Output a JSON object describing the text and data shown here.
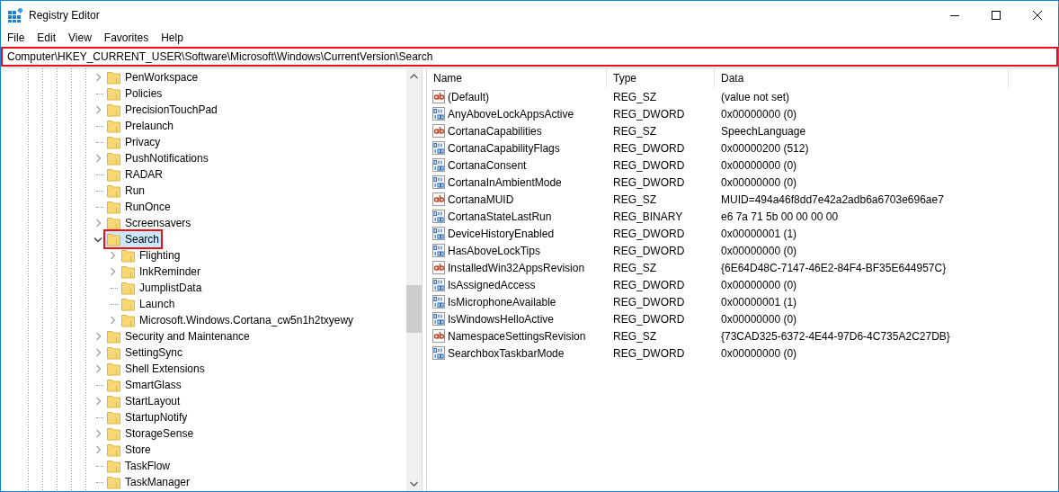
{
  "window": {
    "title": "Registry Editor"
  },
  "menu": [
    {
      "label": "File"
    },
    {
      "label": "Edit"
    },
    {
      "label": "View"
    },
    {
      "label": "Favorites"
    },
    {
      "label": "Help"
    }
  ],
  "address_bar": {
    "value": "Computer\\HKEY_CURRENT_USER\\Software\\Microsoft\\Windows\\CurrentVersion\\Search",
    "highlighted": true
  },
  "tree": [
    {
      "label": "PenWorkspace",
      "expandable": true,
      "expanded": false,
      "selected": false,
      "highlighted": false
    },
    {
      "label": "Policies",
      "expandable": false,
      "expanded": false,
      "selected": false,
      "highlighted": false
    },
    {
      "label": "PrecisionTouchPad",
      "expandable": true,
      "expanded": false,
      "selected": false,
      "highlighted": false
    },
    {
      "label": "Prelaunch",
      "expandable": false,
      "expanded": false,
      "selected": false,
      "highlighted": false
    },
    {
      "label": "Privacy",
      "expandable": false,
      "expanded": false,
      "selected": false,
      "highlighted": false
    },
    {
      "label": "PushNotifications",
      "expandable": true,
      "expanded": false,
      "selected": false,
      "highlighted": false
    },
    {
      "label": "RADAR",
      "expandable": false,
      "expanded": false,
      "selected": false,
      "highlighted": false
    },
    {
      "label": "Run",
      "expandable": false,
      "expanded": false,
      "selected": false,
      "highlighted": false
    },
    {
      "label": "RunOnce",
      "expandable": false,
      "expanded": false,
      "selected": false,
      "highlighted": false
    },
    {
      "label": "Screensavers",
      "expandable": true,
      "expanded": false,
      "selected": false,
      "highlighted": false
    },
    {
      "label": "Search",
      "expandable": true,
      "expanded": true,
      "selected": true,
      "highlighted": true,
      "children": [
        {
          "label": "Flighting",
          "expandable": true,
          "expanded": false,
          "selected": false,
          "highlighted": false
        },
        {
          "label": "InkReminder",
          "expandable": true,
          "expanded": false,
          "selected": false,
          "highlighted": false
        },
        {
          "label": "JumplistData",
          "expandable": false,
          "expanded": false,
          "selected": false,
          "highlighted": false
        },
        {
          "label": "Launch",
          "expandable": false,
          "expanded": false,
          "selected": false,
          "highlighted": false
        },
        {
          "label": "Microsoft.Windows.Cortana_cw5n1h2txyewy",
          "expandable": true,
          "expanded": false,
          "selected": false,
          "highlighted": false
        }
      ]
    },
    {
      "label": "Security and Maintenance",
      "expandable": true,
      "expanded": false,
      "selected": false,
      "highlighted": false
    },
    {
      "label": "SettingSync",
      "expandable": true,
      "expanded": false,
      "selected": false,
      "highlighted": false
    },
    {
      "label": "Shell Extensions",
      "expandable": true,
      "expanded": false,
      "selected": false,
      "highlighted": false
    },
    {
      "label": "SmartGlass",
      "expandable": false,
      "expanded": false,
      "selected": false,
      "highlighted": false
    },
    {
      "label": "StartLayout",
      "expandable": true,
      "expanded": false,
      "selected": false,
      "highlighted": false
    },
    {
      "label": "StartupNotify",
      "expandable": false,
      "expanded": false,
      "selected": false,
      "highlighted": false
    },
    {
      "label": "StorageSense",
      "expandable": true,
      "expanded": false,
      "selected": false,
      "highlighted": false
    },
    {
      "label": "Store",
      "expandable": true,
      "expanded": false,
      "selected": false,
      "highlighted": false
    },
    {
      "label": "TaskFlow",
      "expandable": false,
      "expanded": false,
      "selected": false,
      "highlighted": false
    },
    {
      "label": "TaskManager",
      "expandable": false,
      "expanded": false,
      "selected": false,
      "highlighted": false
    }
  ],
  "values": {
    "columns": [
      "Name",
      "Type",
      "Data"
    ],
    "rows": [
      {
        "kind": "string",
        "name": "(Default)",
        "type": "REG_SZ",
        "data": "(value not set)"
      },
      {
        "kind": "binary",
        "name": "AnyAboveLockAppsActive",
        "type": "REG_DWORD",
        "data": "0x00000000 (0)"
      },
      {
        "kind": "string",
        "name": "CortanaCapabilities",
        "type": "REG_SZ",
        "data": "SpeechLanguage"
      },
      {
        "kind": "binary",
        "name": "CortanaCapabilityFlags",
        "type": "REG_DWORD",
        "data": "0x00000200 (512)"
      },
      {
        "kind": "binary",
        "name": "CortanaConsent",
        "type": "REG_DWORD",
        "data": "0x00000000 (0)"
      },
      {
        "kind": "binary",
        "name": "CortanaInAmbientMode",
        "type": "REG_DWORD",
        "data": "0x00000000 (0)"
      },
      {
        "kind": "string",
        "name": "CortanaMUID",
        "type": "REG_SZ",
        "data": "MUID=494a46f8dd7e42a2adb6a6703e696ae7"
      },
      {
        "kind": "binary",
        "name": "CortanaStateLastRun",
        "type": "REG_BINARY",
        "data": "e6 7a 71 5b 00 00 00 00"
      },
      {
        "kind": "binary",
        "name": "DeviceHistoryEnabled",
        "type": "REG_DWORD",
        "data": "0x00000001 (1)"
      },
      {
        "kind": "binary",
        "name": "HasAboveLockTips",
        "type": "REG_DWORD",
        "data": "0x00000000 (0)"
      },
      {
        "kind": "string",
        "name": "InstalledWin32AppsRevision",
        "type": "REG_SZ",
        "data": "{6E64D48C-7147-46E2-84F4-BF35E644957C}"
      },
      {
        "kind": "binary",
        "name": "IsAssignedAccess",
        "type": "REG_DWORD",
        "data": "0x00000000 (0)"
      },
      {
        "kind": "binary",
        "name": "IsMicrophoneAvailable",
        "type": "REG_DWORD",
        "data": "0x00000001 (1)"
      },
      {
        "kind": "binary",
        "name": "IsWindowsHelloActive",
        "type": "REG_DWORD",
        "data": "0x00000000 (0)"
      },
      {
        "kind": "string",
        "name": "NamespaceSettingsRevision",
        "type": "REG_SZ",
        "data": "{73CAD325-6372-4E44-97D6-4C735A2C27DB}"
      },
      {
        "kind": "binary",
        "name": "SearchboxTaskbarMode",
        "type": "REG_DWORD",
        "data": "0x00000000 (0)"
      }
    ]
  }
}
